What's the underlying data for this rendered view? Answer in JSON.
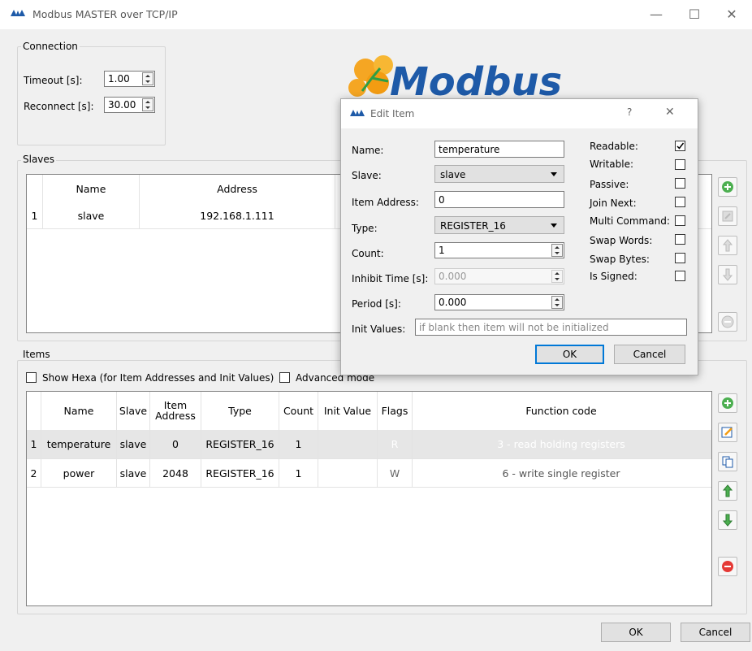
{
  "window": {
    "title": "Modbus MASTER over TCP/IP",
    "minimize": "—",
    "maximize": "☐",
    "close": "✕"
  },
  "connection": {
    "group_label": "Connection",
    "timeout_label": "Timeout [s]:",
    "timeout_value": "1.00",
    "reconnect_label": "Reconnect [s]:",
    "reconnect_value": "30.00"
  },
  "logo_text": "Modbus",
  "slaves": {
    "group_label": "Slaves",
    "headers": [
      "Name",
      "Address"
    ],
    "rows": [
      {
        "num": "1",
        "name": "slave",
        "address": "192.168.1.111"
      }
    ]
  },
  "items": {
    "group_label": "Items",
    "show_hexa_label": "Show Hexa (for Item Addresses and Init Values)",
    "advanced_label": "Advanced mode",
    "headers": [
      "Name",
      "Slave",
      "Item Address",
      "Type",
      "Count",
      "Init Value",
      "Flags",
      "Function code"
    ],
    "rows": [
      {
        "num": "1",
        "name": "temperature",
        "slave": "slave",
        "address": "0",
        "type": "REGISTER_16",
        "count": "1",
        "init": "",
        "flags": "R",
        "function": "3 - read holding registers"
      },
      {
        "num": "2",
        "name": "power",
        "slave": "slave",
        "address": "2048",
        "type": "REGISTER_16",
        "count": "1",
        "init": "",
        "flags": "W",
        "function": "6 - write single register"
      }
    ]
  },
  "footer": {
    "ok": "OK",
    "cancel": "Cancel"
  },
  "dialog": {
    "title": "Edit Item",
    "help": "?",
    "close": "✕",
    "name_label": "Name:",
    "name_value": "temperature",
    "slave_label": "Slave:",
    "slave_value": "slave",
    "address_label": "Item Address:",
    "address_value": "0",
    "type_label": "Type:",
    "type_value": "REGISTER_16",
    "count_label": "Count:",
    "count_value": "1",
    "inhibit_label": "Inhibit Time [s]:",
    "inhibit_value": "0.000",
    "period_label": "Period [s]:",
    "period_value": "0.000",
    "init_label": "Init Values:",
    "init_placeholder": "if blank then item will not be initialized",
    "checks": [
      {
        "label": "Readable:",
        "checked": true
      },
      {
        "label": "Writable:",
        "checked": false
      },
      {
        "label": "Passive:",
        "checked": false
      },
      {
        "label": "Join Next:",
        "checked": false
      },
      {
        "label": "Multi Command:",
        "checked": false
      },
      {
        "label": "Swap Words:",
        "checked": false
      },
      {
        "label": "Swap Bytes:",
        "checked": false
      },
      {
        "label": "Is Signed:",
        "checked": false
      }
    ],
    "ok": "OK",
    "cancel": "Cancel"
  },
  "colors": {
    "selection": "#e6e6e6",
    "accent_blue": "#0078d7",
    "logo_orange": "#f5a623",
    "logo_blue": "#1e5aa8"
  }
}
